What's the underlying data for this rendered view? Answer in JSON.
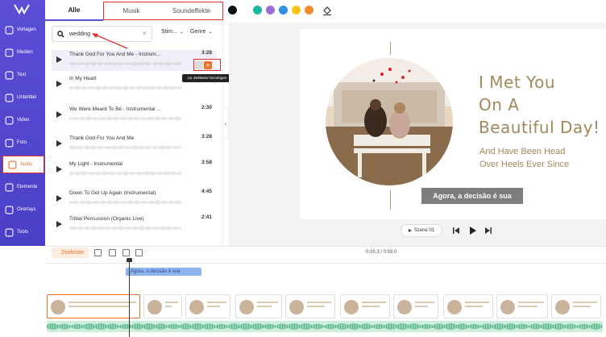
{
  "sidebar": {
    "items": [
      {
        "label": "Vorlagen",
        "icon": "template-icon"
      },
      {
        "label": "Medien",
        "icon": "media-icon"
      },
      {
        "label": "Text",
        "icon": "text-icon"
      },
      {
        "label": "Untertitel",
        "icon": "subtitle-icon"
      },
      {
        "label": "Video",
        "icon": "video-icon"
      },
      {
        "label": "Foto",
        "icon": "photo-icon"
      },
      {
        "label": "Audio",
        "icon": "audio-icon"
      },
      {
        "label": "Elemente",
        "icon": "elements-icon"
      },
      {
        "label": "Overlays",
        "icon": "overlays-icon"
      },
      {
        "label": "Tools",
        "icon": "tools-icon"
      }
    ],
    "active": "Audio"
  },
  "panel": {
    "tabs": [
      "Alle",
      "Musik",
      "Soundeffekte"
    ],
    "active_tab": "Alle",
    "search": {
      "value": "wedding",
      "icon": "search-icon"
    },
    "filters": [
      "Stim...",
      "Genre"
    ],
    "tracks": [
      {
        "title": "Thank God For You And Me - Instrum...",
        "duration": "3:28"
      },
      {
        "title": "In My Heart",
        "duration": ""
      },
      {
        "title": "We Were Meant To Be - Instrumental ...",
        "duration": "2:30"
      },
      {
        "title": "Thank God For You And Me",
        "duration": "3:28"
      },
      {
        "title": "My Light - Instrumental",
        "duration": "3:58"
      },
      {
        "title": "Down To Get Up Again (Instrumental)",
        "duration": "4:45"
      },
      {
        "title": "Tribal Percussion (Organic Live)",
        "duration": "2:41"
      }
    ],
    "tooltip": "zur Zeitleiste hinzufügen"
  },
  "toolbar": {
    "colors": [
      "#111111",
      "#19b8a0",
      "#9b6dd6",
      "#2f8fe0",
      "#f5c518",
      "#f08a2a"
    ]
  },
  "canvas": {
    "heading_lines": [
      "I Met You",
      "On A",
      "Beautiful Day!"
    ],
    "sub_lines": [
      "And Have Been Head",
      "Over Heels Ever Since"
    ],
    "caption": "Agora, a decisão é sua",
    "scene_label": "Szene 01",
    "text_color": "#a08a5c"
  },
  "timeline": {
    "label": "Zeitleiste",
    "time": "0:05.3 / 0:59.0",
    "text_clip": "Agora, a decisão é sua"
  }
}
